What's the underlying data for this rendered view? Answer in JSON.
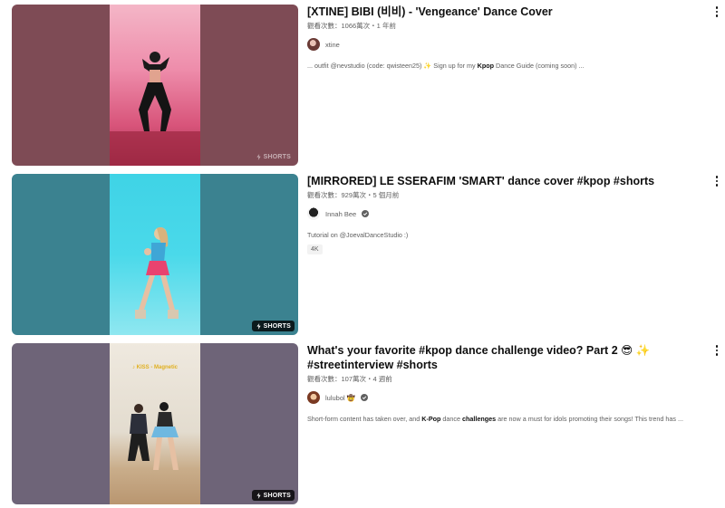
{
  "results": [
    {
      "title": "[XTINE] BIBI (비비) - 'Vengeance' Dance Cover",
      "meta": "觀看次數：1066萬次・1 年前",
      "channel": "xtine",
      "desc_parts": [
        {
          "t": "... outfit @nevstudio (code: qwisteen25) ✨ Sign up for my ",
          "b": false
        },
        {
          "t": "Kpop",
          "b": true
        },
        {
          "t": " Dance Guide (coming soon) ...",
          "b": false
        }
      ],
      "badge": "SHORTS",
      "chip": "",
      "colors": {
        "side": "#7e4b55",
        "bg_top": "#ee8dab",
        "bg_bottom": "#c9415f",
        "avatar": "#b07a6e"
      }
    },
    {
      "title": "[MIRRORED] LE SSERAFIM 'SMART' dance cover #kpop #shorts",
      "meta": "觀看次數：929萬次・5 個月前",
      "channel": "Innah Bee",
      "desc_parts": [
        {
          "t": "Tutorial on @JoevalDanceStudio :)",
          "b": false
        }
      ],
      "badge": "SHORTS",
      "chip": "4K",
      "colors": {
        "side": "#3b8290",
        "bg_top": "#31cfe3",
        "bg_bottom": "#78e3ee",
        "avatar": "#2a2a2a"
      }
    },
    {
      "title": "What's your favorite #kpop dance challenge video? Part 2 😎 ✨ #streetinterview #shorts",
      "meta": "觀看次數：107萬次・4 週前",
      "channel": "lulubol 🤠",
      "desc_parts": [
        {
          "t": "Short-form content has taken over, and ",
          "b": false
        },
        {
          "t": "K-Pop",
          "b": true
        },
        {
          "t": " dance ",
          "b": false
        },
        {
          "t": "challenges",
          "b": true
        },
        {
          "t": " are now a must for idols promoting their songs! This trend has ...",
          "b": false
        }
      ],
      "badge": "SHORTS",
      "chip": "",
      "overlay_text": "♪ KISS - Magnetic",
      "colors": {
        "side": "#6e6478",
        "bg_top": "#e8e2d6",
        "bg_bottom": "#cdb89c",
        "avatar": "#8b4a2f"
      }
    }
  ]
}
